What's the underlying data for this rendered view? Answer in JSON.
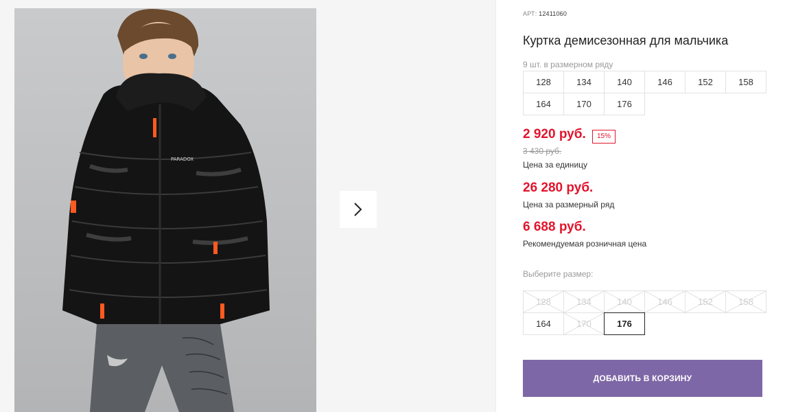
{
  "product": {
    "art_label": "АРТ:",
    "art_number": "12411060",
    "title": "Куртка демисезонная для мальчика",
    "series_note": "9 шт. в размерном ряду",
    "series_sizes": [
      "128",
      "134",
      "140",
      "146",
      "152",
      "158",
      "164",
      "170",
      "176"
    ]
  },
  "pricing": {
    "unit_price": "2 920 руб.",
    "discount_badge": "15%",
    "old_price": "3 430 руб.",
    "unit_label": "Цена за единицу",
    "series_price": "26 280 руб.",
    "series_label": "Цена за размерный ряд",
    "retail_price": "6 688 руб.",
    "retail_label": "Рекомендуемая розничная цена"
  },
  "size_select": {
    "label": "Выберите размер:",
    "sizes": [
      {
        "value": "128",
        "available": false
      },
      {
        "value": "134",
        "available": false
      },
      {
        "value": "140",
        "available": false
      },
      {
        "value": "146",
        "available": false
      },
      {
        "value": "152",
        "available": false
      },
      {
        "value": "158",
        "available": false
      },
      {
        "value": "164",
        "available": true
      },
      {
        "value": "170",
        "available": false
      },
      {
        "value": "176",
        "available": true,
        "selected": true
      }
    ]
  },
  "actions": {
    "add_to_cart": "ДОБАВИТЬ В КОРЗИНУ"
  },
  "gallery": {
    "next_icon": "chevron-right-icon",
    "photo_text": "PARADOX"
  },
  "colors": {
    "accent_red": "#e3142c",
    "button_purple": "#7e67a6"
  }
}
